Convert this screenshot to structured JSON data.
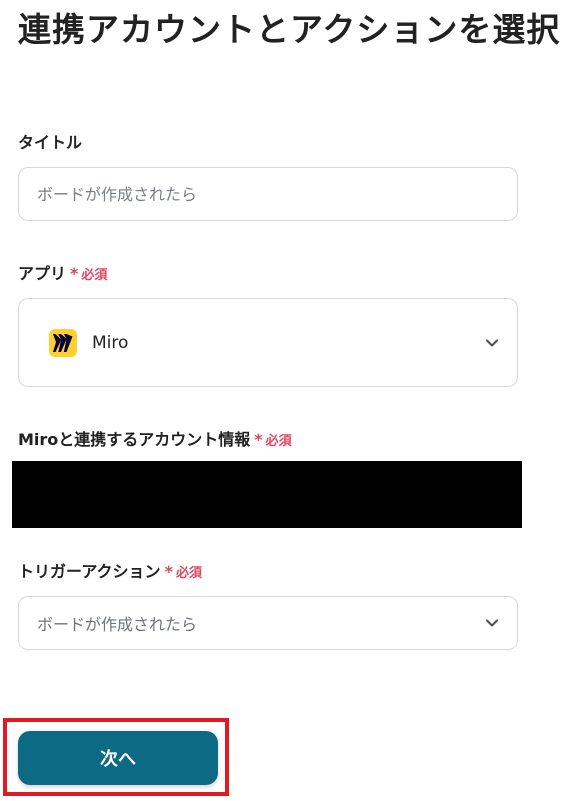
{
  "page": {
    "title": "連携アカウントとアクションを選択"
  },
  "required_marker": {
    "star": "*",
    "text": "必須",
    "color": "#e0475f"
  },
  "fields": {
    "title": {
      "label": "タイトル",
      "value": "",
      "placeholder": "ボードが作成されたら"
    },
    "app": {
      "label": "アプリ",
      "selected": "Miro",
      "icon": "miro-logo-icon"
    },
    "account": {
      "label": "Miroと連携するアカウント情報"
    },
    "trigger_action": {
      "label": "トリガーアクション",
      "selected": "ボードが作成されたら"
    }
  },
  "actions": {
    "next_label": "次へ"
  },
  "colors": {
    "primary_button": "#0d6a85",
    "highlight": "#e01b24",
    "miro_yellow": "#ffd02f"
  }
}
